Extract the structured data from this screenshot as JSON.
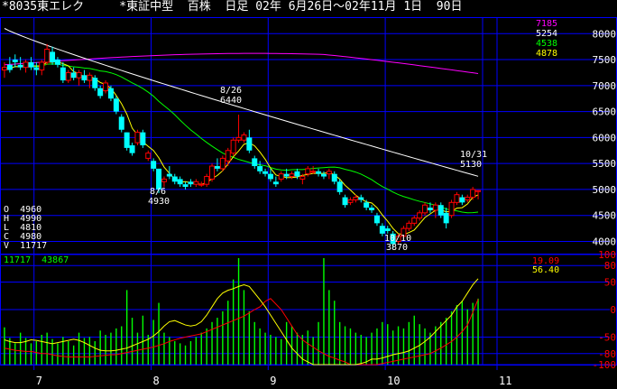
{
  "header": {
    "title": "*8035東エレク     *東証中型  百株  日足 02年 6月26日～02年11月 1日  90日"
  },
  "colors": {
    "background": "#000000",
    "grid": "#0000ff",
    "candle_up": "#ff0000",
    "candle_down": "#00ffff",
    "ma_short": "#ffff00",
    "ma_mid": "#00ff00",
    "ma_long": "#ffffff",
    "ma_longest": "#ff00ff",
    "volume": "#00ff00",
    "osc_yellow": "#ffff00",
    "osc_red": "#ff0000"
  },
  "ma_legend": [
    {
      "value": "7185",
      "color": "#ff00ff"
    },
    {
      "value": "5254",
      "color": "#ffffff"
    },
    {
      "value": "4538",
      "color": "#00ff00"
    },
    {
      "value": "4878",
      "color": "#ffff00"
    }
  ],
  "ohlc": [
    {
      "label": "O",
      "value": "4960"
    },
    {
      "label": "H",
      "value": "4990"
    },
    {
      "label": "L",
      "value": "4810"
    },
    {
      "label": "C",
      "value": "4980"
    },
    {
      "label": "V",
      "value": "11717"
    }
  ],
  "volume_readout": "11717  43867",
  "osc_readout": [
    {
      "value": "19.09",
      "color": "#ff0000"
    },
    {
      "value": "56.40",
      "color": "#ffff00"
    }
  ],
  "annotations": [
    {
      "date": "8/26",
      "price": "6440"
    },
    {
      "date": "8/6",
      "price": "4930"
    },
    {
      "date": "10/10",
      "price": "3870"
    },
    {
      "date": "10/31",
      "price": "5130"
    }
  ],
  "chart_data": {
    "type": "candlestick",
    "price_axis": {
      "ticks": [
        "8000",
        "7500",
        "7000",
        "6500",
        "6000",
        "5500",
        "5000",
        "4500",
        "4000"
      ],
      "range": [
        3800,
        8300
      ]
    },
    "osc_axis": {
      "ticks": [
        "100",
        "80",
        "50",
        "0",
        "-50",
        "-80",
        "-100"
      ],
      "range": [
        -100,
        100
      ]
    },
    "month_labels": [
      "7",
      "8",
      "9",
      "10",
      "11"
    ],
    "month_start_index": [
      3,
      25,
      47,
      69,
      90
    ],
    "candles": [
      [
        7300,
        7450,
        7150,
        7350
      ],
      [
        7400,
        7550,
        7250,
        7300
      ],
      [
        7500,
        7600,
        7350,
        7450
      ],
      [
        7400,
        7550,
        7300,
        7350
      ],
      [
        7350,
        7500,
        7250,
        7450
      ],
      [
        7450,
        7550,
        7300,
        7350
      ],
      [
        7350,
        7450,
        7200,
        7300
      ],
      [
        7300,
        7500,
        7200,
        7450
      ],
      [
        7450,
        7800,
        7400,
        7700
      ],
      [
        7650,
        7750,
        7400,
        7450
      ],
      [
        7500,
        7550,
        7350,
        7400
      ],
      [
        7350,
        7450,
        7050,
        7100
      ],
      [
        7100,
        7300,
        7050,
        7250
      ],
      [
        7250,
        7350,
        7100,
        7150
      ],
      [
        7150,
        7300,
        7000,
        7250
      ],
      [
        7200,
        7300,
        7050,
        7100
      ],
      [
        7100,
        7250,
        6950,
        7200
      ],
      [
        7150,
        7200,
        6900,
        6950
      ],
      [
        6950,
        7000,
        6750,
        6800
      ],
      [
        6900,
        7100,
        6850,
        7050
      ],
      [
        6950,
        7000,
        6700,
        6750
      ],
      [
        6750,
        6800,
        6450,
        6500
      ],
      [
        6400,
        6450,
        6100,
        6150
      ],
      [
        6100,
        6100,
        5750,
        5800
      ],
      [
        5850,
        5900,
        5650,
        5700
      ],
      [
        5900,
        6150,
        5850,
        6100
      ],
      [
        6100,
        6150,
        5800,
        5850
      ],
      [
        5600,
        5750,
        5550,
        5700
      ],
      [
        5550,
        5600,
        5350,
        5400
      ],
      [
        5400,
        5400,
        4930,
        5000
      ],
      [
        5150,
        5250,
        5050,
        5200
      ],
      [
        5300,
        5450,
        5200,
        5250
      ],
      [
        5250,
        5300,
        5100,
        5150
      ],
      [
        5200,
        5250,
        5050,
        5100
      ],
      [
        5100,
        5150,
        5000,
        5050
      ],
      [
        5150,
        5200,
        5050,
        5100
      ],
      [
        5100,
        5200,
        5050,
        5150
      ],
      [
        5100,
        5150,
        5050,
        5100
      ],
      [
        5100,
        5300,
        5050,
        5250
      ],
      [
        5200,
        5500,
        5150,
        5450
      ],
      [
        5450,
        5600,
        5350,
        5400
      ],
      [
        5400,
        5650,
        5350,
        5600
      ],
      [
        5550,
        5800,
        5450,
        5750
      ],
      [
        5700,
        6000,
        5650,
        5950
      ],
      [
        5950,
        6440,
        5900,
        6000
      ],
      [
        5950,
        6100,
        5900,
        6050
      ],
      [
        6000,
        6150,
        5700,
        5750
      ],
      [
        5600,
        5650,
        5400,
        5450
      ],
      [
        5450,
        5550,
        5300,
        5350
      ],
      [
        5350,
        5400,
        5250,
        5300
      ],
      [
        5300,
        5400,
        5150,
        5200
      ],
      [
        5150,
        5250,
        5050,
        5100
      ],
      [
        5200,
        5350,
        5150,
        5300
      ],
      [
        5300,
        5400,
        5200,
        5250
      ],
      [
        5250,
        5350,
        5200,
        5300
      ],
      [
        5350,
        5400,
        5200,
        5250
      ],
      [
        5200,
        5300,
        5100,
        5250
      ],
      [
        5300,
        5450,
        5250,
        5400
      ],
      [
        5350,
        5450,
        5300,
        5350
      ],
      [
        5350,
        5400,
        5250,
        5300
      ],
      [
        5300,
        5350,
        5200,
        5250
      ],
      [
        5300,
        5400,
        5200,
        5350
      ],
      [
        5300,
        5350,
        5100,
        5150
      ],
      [
        5150,
        5200,
        4900,
        4950
      ],
      [
        4850,
        4900,
        4650,
        4700
      ],
      [
        4750,
        4850,
        4700,
        4800
      ],
      [
        4800,
        4900,
        4750,
        4850
      ],
      [
        4850,
        4900,
        4750,
        4800
      ],
      [
        4750,
        4800,
        4600,
        4650
      ],
      [
        4650,
        4700,
        4550,
        4600
      ],
      [
        4500,
        4550,
        4300,
        4350
      ],
      [
        4300,
        4350,
        4100,
        4150
      ],
      [
        4250,
        4300,
        4150,
        4200
      ],
      [
        4150,
        4200,
        3870,
        3950
      ],
      [
        4000,
        4150,
        3950,
        4100
      ],
      [
        4100,
        4300,
        4050,
        4250
      ],
      [
        4250,
        4400,
        4200,
        4350
      ],
      [
        4350,
        4500,
        4300,
        4450
      ],
      [
        4450,
        4600,
        4400,
        4550
      ],
      [
        4550,
        4750,
        4500,
        4700
      ],
      [
        4650,
        4750,
        4550,
        4600
      ],
      [
        4600,
        4750,
        4450,
        4700
      ],
      [
        4700,
        4750,
        4450,
        4500
      ],
      [
        4550,
        4650,
        4250,
        4350
      ],
      [
        4500,
        4800,
        4450,
        4750
      ],
      [
        4750,
        4950,
        4700,
        4900
      ],
      [
        4850,
        4900,
        4700,
        4750
      ],
      [
        4800,
        4900,
        4750,
        4850
      ],
      [
        4850,
        5050,
        4800,
        5000
      ],
      [
        4960,
        4990,
        4810,
        4980
      ]
    ],
    "volume": [
      35,
      25,
      20,
      30,
      25,
      20,
      22,
      28,
      30,
      24,
      20,
      26,
      22,
      18,
      30,
      25,
      26,
      22,
      32,
      28,
      30,
      34,
      36,
      70,
      44,
      30,
      46,
      28,
      42,
      58,
      30,
      26,
      22,
      20,
      18,
      22,
      26,
      30,
      34,
      40,
      44,
      50,
      60,
      80,
      100,
      70,
      50,
      40,
      34,
      30,
      28,
      26,
      24,
      40,
      36,
      30,
      28,
      32,
      26,
      40,
      100,
      70,
      60,
      40,
      36,
      34,
      30,
      28,
      26,
      30,
      34,
      40,
      38,
      32,
      36,
      34,
      40,
      46,
      38,
      34,
      30,
      36,
      40,
      44,
      50,
      56,
      60,
      52,
      58,
      62
    ],
    "osc_yellow": [
      -55,
      -58,
      -60,
      -60,
      -58,
      -55,
      -56,
      -58,
      -60,
      -62,
      -60,
      -58,
      -56,
      -54,
      -56,
      -60,
      -65,
      -70,
      -74,
      -75,
      -75,
      -74,
      -72,
      -70,
      -66,
      -62,
      -58,
      -54,
      -48,
      -40,
      -30,
      -22,
      -20,
      -24,
      -28,
      -30,
      -28,
      -22,
      -10,
      5,
      20,
      30,
      35,
      38,
      42,
      45,
      42,
      30,
      18,
      5,
      -10,
      -25,
      -40,
      -55,
      -70,
      -80,
      -90,
      -95,
      -100,
      -100,
      -100,
      -100,
      -100,
      -100,
      -100,
      -100,
      -100,
      -98,
      -95,
      -90,
      -90,
      -88,
      -85,
      -82,
      -80,
      -78,
      -75,
      -70,
      -65,
      -58,
      -50,
      -40,
      -30,
      -20,
      -10,
      5,
      15,
      30,
      45,
      56
    ],
    "osc_red": [
      -70,
      -72,
      -74,
      -75,
      -76,
      -76,
      -78,
      -80,
      -80,
      -82,
      -84,
      -85,
      -86,
      -86,
      -86,
      -86,
      -86,
      -85,
      -84,
      -83,
      -82,
      -82,
      -80,
      -78,
      -76,
      -74,
      -72,
      -70,
      -68,
      -65,
      -62,
      -58,
      -55,
      -52,
      -50,
      -48,
      -46,
      -44,
      -40,
      -36,
      -32,
      -28,
      -24,
      -20,
      -16,
      -12,
      -6,
      0,
      5,
      15,
      20,
      10,
      0,
      -15,
      -30,
      -45,
      -55,
      -62,
      -68,
      -75,
      -80,
      -85,
      -88,
      -92,
      -95,
      -100,
      -100,
      -100,
      -100,
      -100,
      -100,
      -98,
      -96,
      -94,
      -92,
      -90,
      -88,
      -86,
      -84,
      -82,
      -80,
      -75,
      -70,
      -64,
      -58,
      -50,
      -40,
      -28,
      -5,
      19
    ]
  }
}
